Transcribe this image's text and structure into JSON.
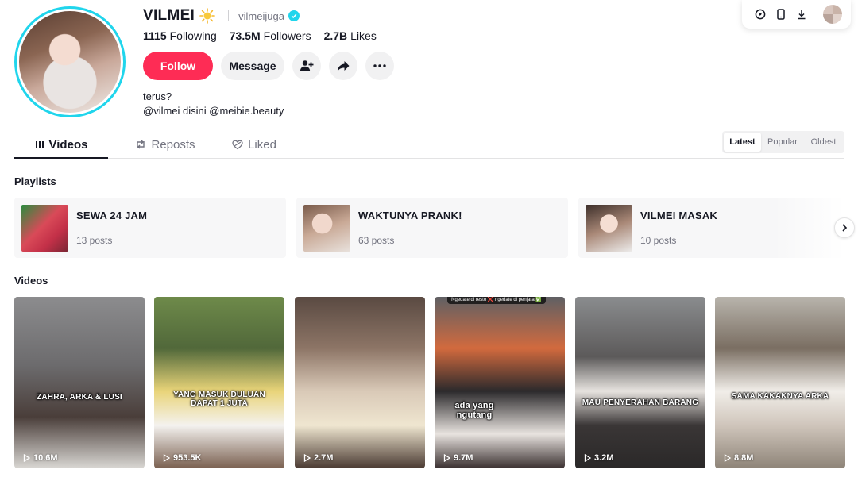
{
  "profile": {
    "username": "VILMEI",
    "handle": "vilmeijuga",
    "stats": [
      {
        "value": "1115",
        "label": "Following"
      },
      {
        "value": "73.5M",
        "label": "Followers"
      },
      {
        "value": "2.7B",
        "label": "Likes"
      }
    ],
    "bio_line1": "terus?",
    "bio_line2": "@vilmei disini @meibie.beauty"
  },
  "actions": {
    "follow_label": "Follow",
    "message_label": "Message"
  },
  "tabs": [
    {
      "label": "Videos",
      "icon": "grid-icon"
    },
    {
      "label": "Reposts",
      "icon": "repost-icon"
    },
    {
      "label": "Liked",
      "icon": "heart-icon"
    }
  ],
  "sort": [
    "Latest",
    "Popular",
    "Oldest"
  ],
  "sections": {
    "playlists_title": "Playlists",
    "videos_title": "Videos"
  },
  "playlists": [
    {
      "title": "SEWA 24 JAM",
      "count": "13 posts"
    },
    {
      "title": "WAKTUNYA PRANK!",
      "count": "63 posts"
    },
    {
      "title": "VILMEI MASAK",
      "count": "10 posts"
    }
  ],
  "videos": [
    {
      "caption": "ZAHRA, ARKA & LUSI",
      "views": "10.6M"
    },
    {
      "caption": "YANG MASUK DULUAN DAPAT 1 JUTA",
      "views": "953.5K"
    },
    {
      "caption": "",
      "views": "2.7M"
    },
    {
      "caption": "ada yang ngutang",
      "views": "9.7M",
      "topbar": "Ngedate di resto ❌ ngedate di penjara ✅"
    },
    {
      "caption": "MAU PENYERAHAN BARANG",
      "views": "3.2M"
    },
    {
      "caption": "SAMA KAKAKNYA ARKA",
      "views": "8.8M"
    }
  ],
  "colors": {
    "accent": "#fe2c55",
    "verified": "#20d5ec",
    "text_primary": "#161823",
    "text_secondary": "#737480"
  }
}
